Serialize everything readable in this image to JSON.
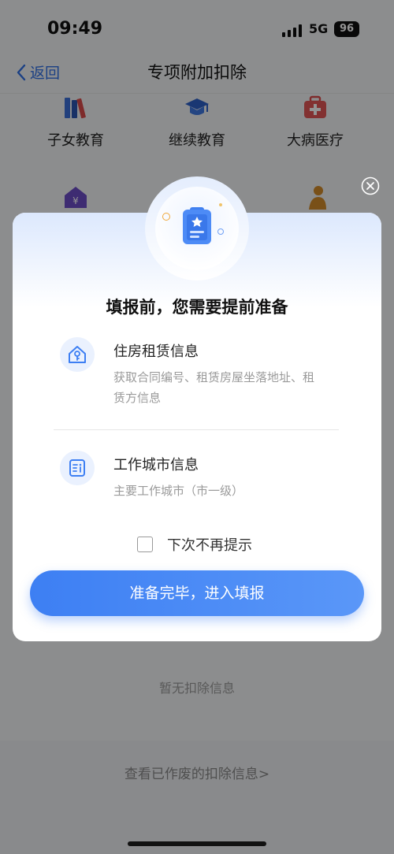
{
  "status": {
    "time": "09:49",
    "network": "5G",
    "battery": "96"
  },
  "nav": {
    "back_label": "返回",
    "title": "专项附加扣除"
  },
  "categories": [
    {
      "label": "子女教育",
      "icon": "books-icon"
    },
    {
      "label": "继续教育",
      "icon": "graduation-cap-icon"
    },
    {
      "label": "大病医疗",
      "icon": "medical-kit-icon"
    }
  ],
  "background": {
    "empty_text": "暂无扣除信息",
    "void_link": "查看已作废的扣除信息>"
  },
  "modal": {
    "title": "填报前，您需要提前准备",
    "items": [
      {
        "title": "住房租赁信息",
        "desc": "获取合同编号、租赁房屋坐落地址、租赁方信息",
        "icon": "house-key-icon"
      },
      {
        "title": "工作城市信息",
        "desc": "主要工作城市（市一级）",
        "icon": "document-info-icon"
      }
    ],
    "checkbox_label": "下次不再提示",
    "checkbox_checked": false,
    "confirm_label": "准备完毕，进入填报"
  },
  "colors": {
    "accent": "#3d7ff3",
    "back_link": "#2f6fe4",
    "overlay": "rgba(0,0,0,0.42)"
  }
}
